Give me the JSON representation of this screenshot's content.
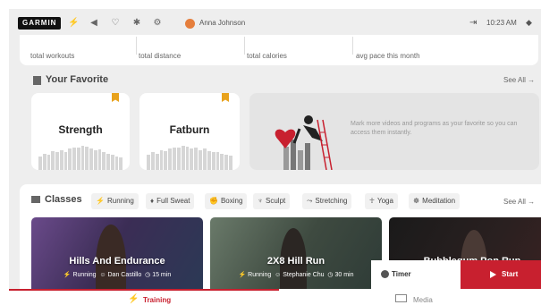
{
  "status_bar": {
    "brand": "GARMIN",
    "user_name": "Anna Johnson",
    "time": "10:23 AM",
    "icons": [
      "running-icon",
      "volume-icon",
      "heart-rate-icon",
      "bluetooth-icon",
      "settings-icon",
      "avatar",
      "exit-icon",
      "wifi-icon"
    ]
  },
  "stats": {
    "labels": [
      "total workouts",
      "total distance",
      "total calories",
      "avg pace this month"
    ]
  },
  "favorites": {
    "title": "Your Favorite",
    "see_all": "See All",
    "cards": [
      "Strength",
      "Fatburn"
    ],
    "hint": "Mark more videos and programs as your favorite so you can access them instantly."
  },
  "classes": {
    "title": "Classes",
    "see_all": "See All",
    "filters": [
      {
        "label": "Running",
        "icon": "running-icon"
      },
      {
        "label": "Full Sweat",
        "icon": "flame-icon"
      },
      {
        "label": "Boxing",
        "icon": "boxing-icon"
      },
      {
        "label": "Sculpt",
        "icon": "sculpt-icon"
      },
      {
        "label": "Stretching",
        "icon": "stretching-icon"
      },
      {
        "label": "Yoga",
        "icon": "yoga-icon"
      },
      {
        "label": "Meditation",
        "icon": "meditation-icon"
      }
    ],
    "tiles": [
      {
        "title": "Hills And Endurance",
        "category": "Running",
        "coach": "Dan Castillo",
        "duration": "15 min"
      },
      {
        "title": "2X8 Hill Run",
        "category": "Running",
        "coach": "Stephanie Chu",
        "duration": "30 min"
      },
      {
        "title": "Bubblegum Pop Run",
        "category": "",
        "coach": "",
        "duration": ""
      }
    ]
  },
  "controls": {
    "timer_label": "Timer",
    "start_label": "Start"
  },
  "bottom_nav": {
    "training": "Training",
    "media": "Media"
  },
  "colors": {
    "accent": "#c8202f",
    "bookmark": "#e8a21c",
    "background": "#eeeeee"
  }
}
